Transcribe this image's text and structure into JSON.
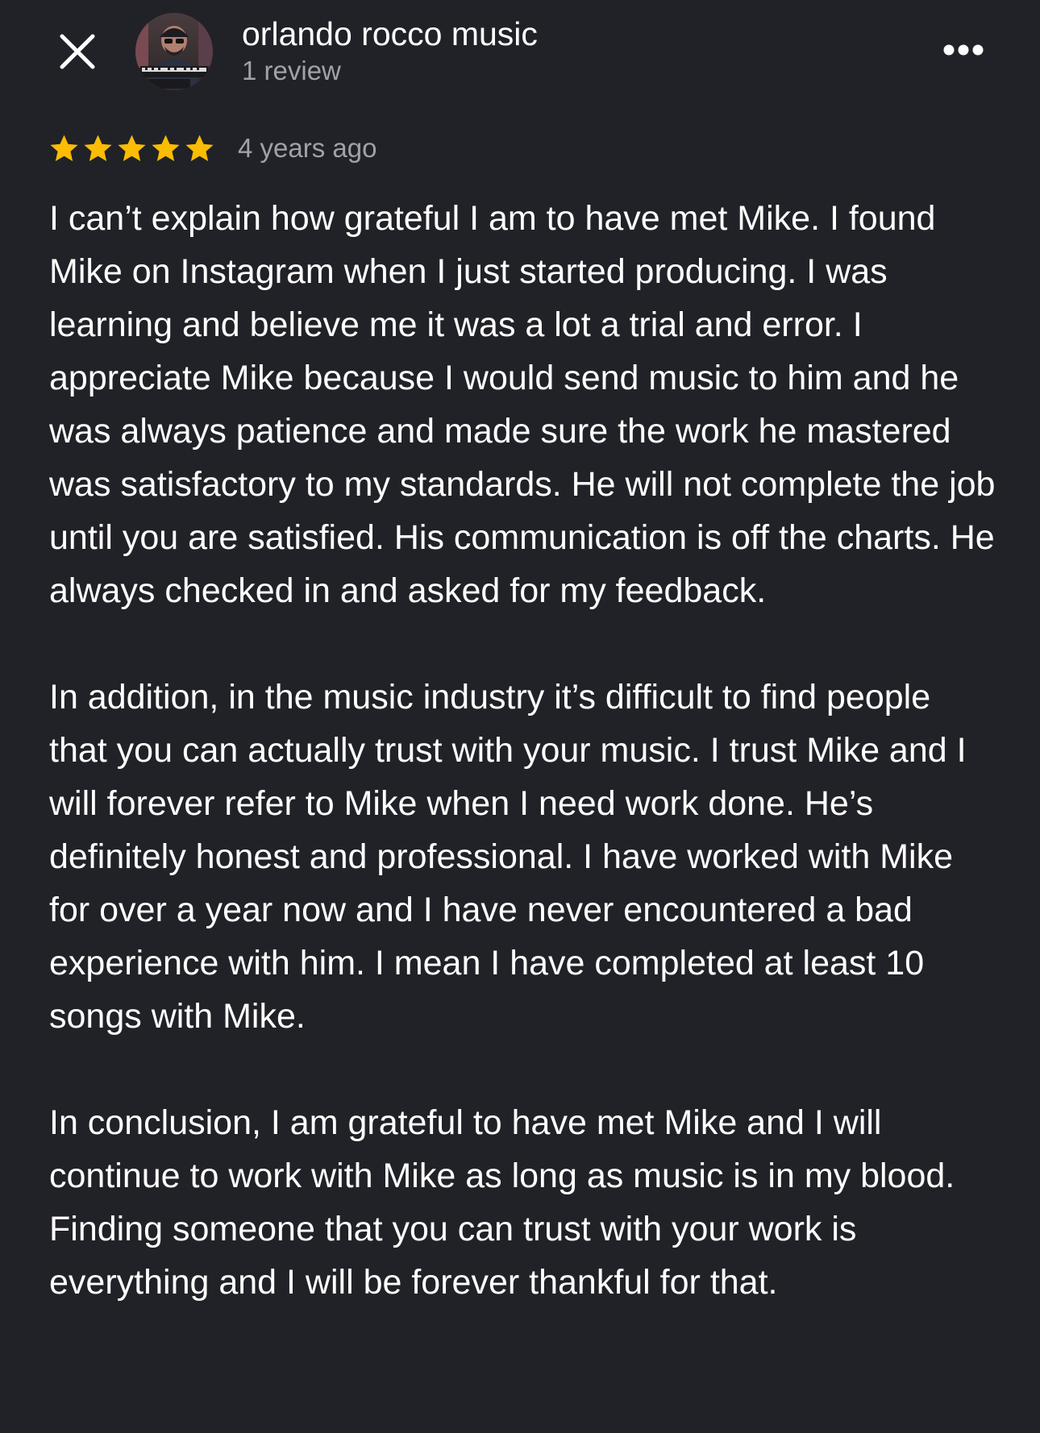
{
  "header": {
    "close_icon": "close-icon",
    "reviewer_name": "orlando rocco music",
    "review_count": "1 review",
    "more_icon": "more-horizontal-icon",
    "avatar_badge_text": "MPKPR"
  },
  "review": {
    "rating": 5,
    "rating_max": 5,
    "star_color": "#fbbc04",
    "timestamp": "4 years ago",
    "paragraphs": [
      "I can’t explain how grateful I am to have met Mike. I found Mike on Instagram when I just started producing. I was learning and believe me it was a lot a trial and error. I appreciate Mike because I would send music to him and he was always patience and made sure the work he mastered was satisfactory to my standards. He will not complete the job until you are satisfied. His communication is off the charts. He always checked in and asked for my feedback.",
      "In addition, in the music industry it’s difficult to find people that you can actually trust with your music. I trust Mike and I will forever refer to Mike when I need work done. He’s definitely honest and professional. I have worked with Mike for over a year now and I have never encountered a bad experience with him. I mean I have completed at least 10 songs with Mike.",
      "In conclusion, I am grateful to have met Mike and I will continue to work with Mike as long as music is in my blood. Finding someone that you can trust with your work is everything and I will be forever thankful for that."
    ]
  },
  "colors": {
    "background": "#212227",
    "primary_text": "#ffffff",
    "secondary_text": "#a0a2a8"
  }
}
